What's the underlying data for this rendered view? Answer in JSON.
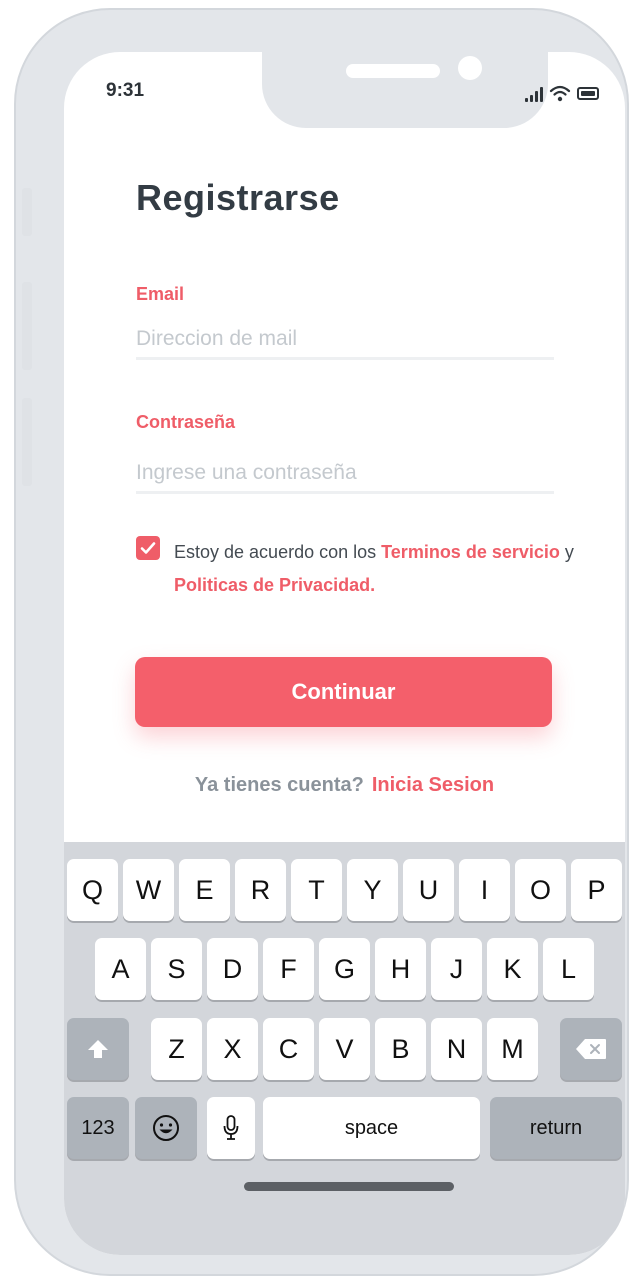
{
  "status_bar": {
    "time": "9:31"
  },
  "page": {
    "title": "Registrarse"
  },
  "form": {
    "email_label": "Email",
    "email_value": "",
    "email_placeholder": "Direccion de mail",
    "password_label": "Contraseña",
    "password_value": "",
    "password_placeholder": "Ingrese una contraseña",
    "terms_checked": true,
    "terms_prefix": "Estoy de acuerdo con los",
    "terms_link": "Terminos de servicio",
    "terms_conj": "y",
    "privacy_link": "Politicas de Privacidad.",
    "submit_label": "Continuar"
  },
  "signin": {
    "question": "Ya tienes cuenta?",
    "link": "Inicia Sesion"
  },
  "keyboard": {
    "row1": [
      "Q",
      "W",
      "E",
      "R",
      "T",
      "Y",
      "U",
      "I",
      "O",
      "P"
    ],
    "row2": [
      "A",
      "S",
      "D",
      "F",
      "G",
      "H",
      "J",
      "K",
      "L"
    ],
    "row3": [
      "Z",
      "X",
      "C",
      "V",
      "B",
      "N",
      "M"
    ],
    "numbers_label": "123",
    "space_label": "space",
    "return_label": "return"
  },
  "colors": {
    "accent": "#ef5d68",
    "button": "#f45f6b",
    "title_text": "#333c44",
    "placeholder": "#c4c9ce",
    "keyboard_bg": "#d3d6db",
    "key_function": "#adb3ba",
    "frame": "#e3e6ea"
  },
  "icons": [
    "signal-icon",
    "wifi-icon",
    "battery-icon",
    "checkmark-icon",
    "shift-icon",
    "backspace-icon",
    "emoji-icon",
    "microphone-icon"
  ]
}
